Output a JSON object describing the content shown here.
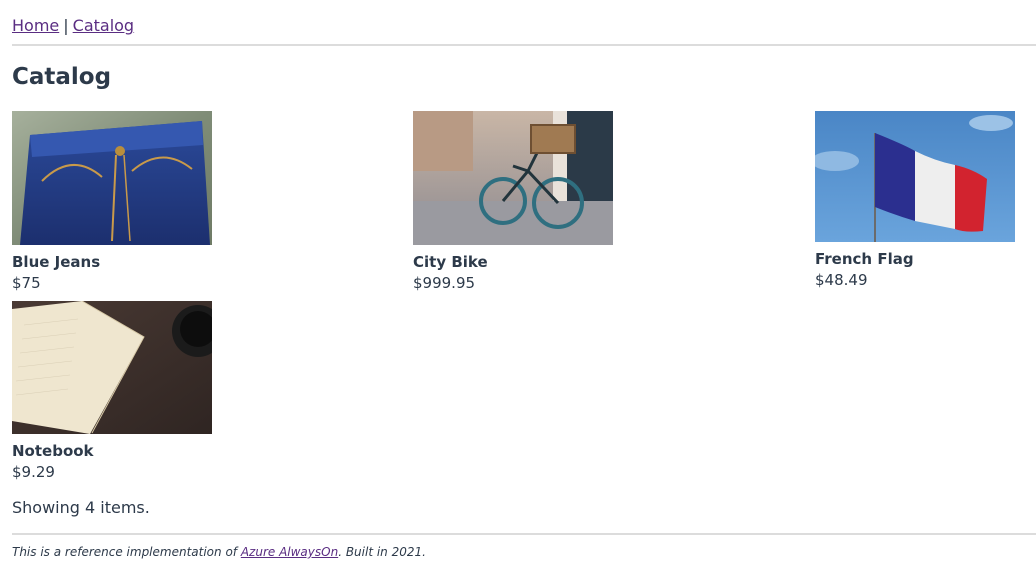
{
  "nav": {
    "home_label": "Home",
    "separator": "|",
    "catalog_label": "Catalog"
  },
  "page": {
    "title": "Catalog"
  },
  "items": [
    {
      "name": "Blue Jeans",
      "price": "$75",
      "image": "blue-jeans-photo"
    },
    {
      "name": "City Bike",
      "price": "$999.95",
      "image": "city-bike-photo"
    },
    {
      "name": "French Flag",
      "price": "$48.49",
      "image": "french-flag-photo"
    },
    {
      "name": "Notebook",
      "price": "$9.29",
      "image": "notebook-photo"
    }
  ],
  "summary": {
    "showing_text": "Showing 4 items."
  },
  "footer": {
    "prefix": "This is a reference implementation of ",
    "link_label": "Azure AlwaysOn",
    "suffix": ". Built in 2021."
  },
  "colors": {
    "text": "#2d3a4a",
    "link": "#5a2d82",
    "rule": "#dcdcdc"
  }
}
